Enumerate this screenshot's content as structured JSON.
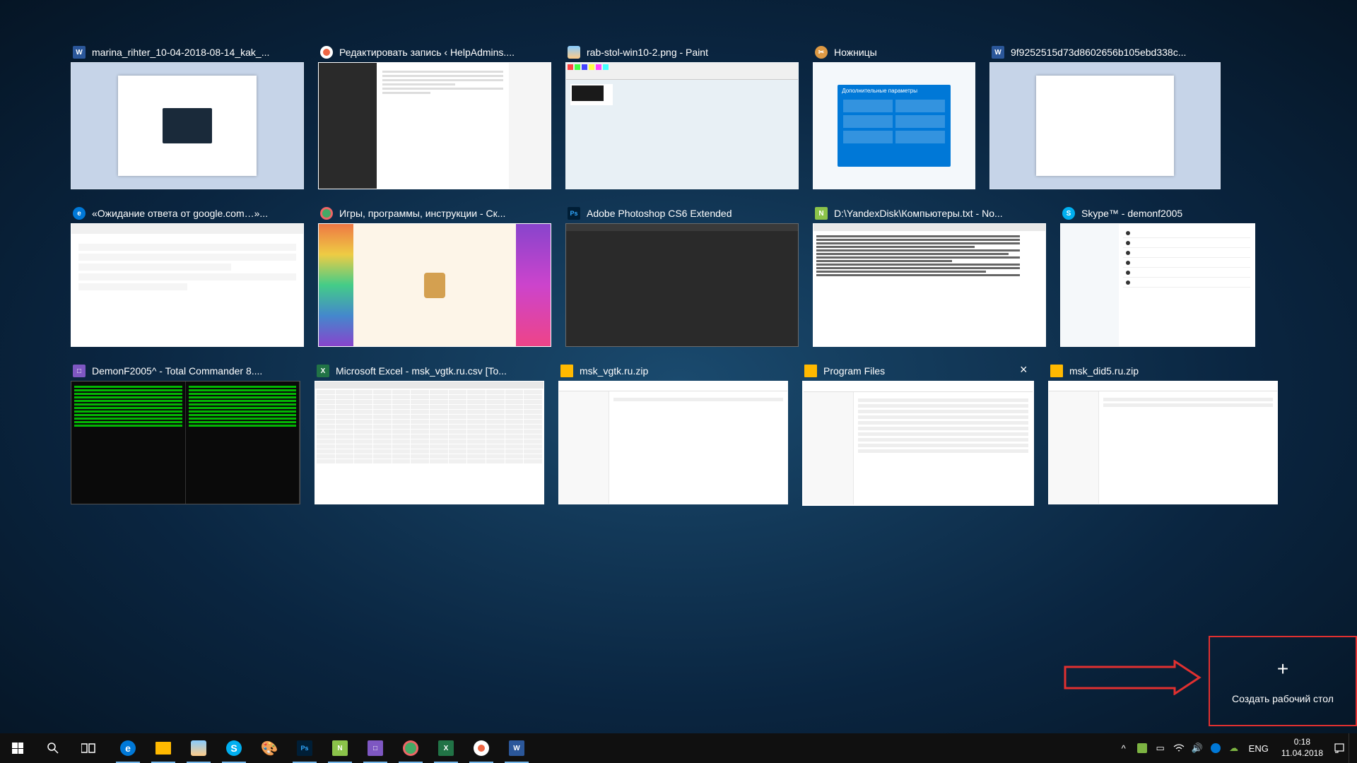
{
  "taskview": {
    "row1": [
      {
        "title": "marina_rihter_10-04-2018-08-14_kak_...",
        "icon": "word"
      },
      {
        "title": "Редактировать запись ‹ HelpAdmins....",
        "icon": "yandex"
      },
      {
        "title": "rab-stol-win10-2.png - Paint",
        "icon": "paint"
      },
      {
        "title": "Ножницы",
        "icon": "snip"
      },
      {
        "title": "9f9252515d73d8602656b105ebd338c...",
        "icon": "word"
      }
    ],
    "row2": [
      {
        "title": "«Ожидание ответа от google.com…»...",
        "icon": "edge"
      },
      {
        "title": "Игры, программы, инструкции - Ск...",
        "icon": "firefox"
      },
      {
        "title": "Adobe Photoshop CS6 Extended",
        "icon": "ps"
      },
      {
        "title": "D:\\YandexDisk\\Компьютеры.txt - No...",
        "icon": "npp"
      },
      {
        "title": "Skype™ - demonf2005",
        "icon": "skype"
      }
    ],
    "row3": [
      {
        "title": "DemonF2005^ - Total Commander 8....",
        "icon": "tc"
      },
      {
        "title": "Microsoft Excel - msk_vgtk.ru.csv  [To...",
        "icon": "excel"
      },
      {
        "title": "msk_vgtk.ru.zip",
        "icon": "folder"
      },
      {
        "title": "Program Files",
        "icon": "folder",
        "hovered": true,
        "close": "×"
      },
      {
        "title": "msk_did5.ru.zip",
        "icon": "folder"
      }
    ]
  },
  "new_desktop": {
    "plus": "+",
    "label": "Создать рабочий стол"
  },
  "taskbar": {
    "lang": "ENG",
    "time": "0:18",
    "date": "11.04.2018"
  },
  "snip_panel_title": "Дополнительные параметры"
}
